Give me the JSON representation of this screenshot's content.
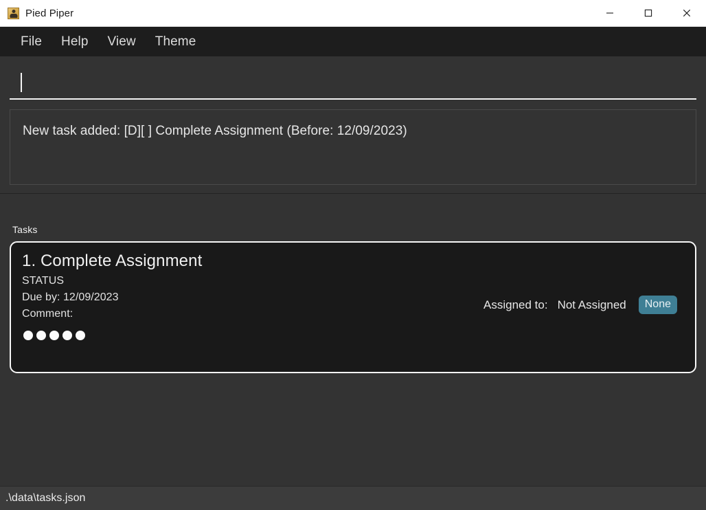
{
  "window": {
    "title": "Pied Piper",
    "icon": "app-person-icon",
    "controls": {
      "minimize": "minimize-icon",
      "maximize": "maximize-icon",
      "close": "close-icon"
    }
  },
  "menubar": {
    "items": [
      {
        "label": "File"
      },
      {
        "label": "Help"
      },
      {
        "label": "View"
      },
      {
        "label": "Theme"
      }
    ]
  },
  "command_input": {
    "value": "",
    "placeholder": ""
  },
  "message_box": {
    "text": "New task added: [D][ ] Complete Assignment (Before: 12/09/2023)"
  },
  "tasks_panel": {
    "label": "Tasks",
    "tasks": [
      {
        "title": "1. Complete Assignment",
        "status": "STATUS",
        "due": "Due by: 12/09/2023",
        "comment": "Comment:",
        "assigned_label": "Assigned to:",
        "assigned_value": "Not Assigned",
        "assigned_badge": "None",
        "dots_count": 5
      }
    ]
  },
  "statusbar": {
    "path": ".\\data\\tasks.json"
  },
  "colors": {
    "window_bg": "#333333",
    "menubar_bg": "#1d1d1d",
    "card_bg": "#191919",
    "card_border": "#f7f7f7",
    "badge_bg": "#3f7f95",
    "statusbar_bg": "#3c3c3c",
    "text_primary": "#eaeaea",
    "accent_left": "#2a4278"
  }
}
